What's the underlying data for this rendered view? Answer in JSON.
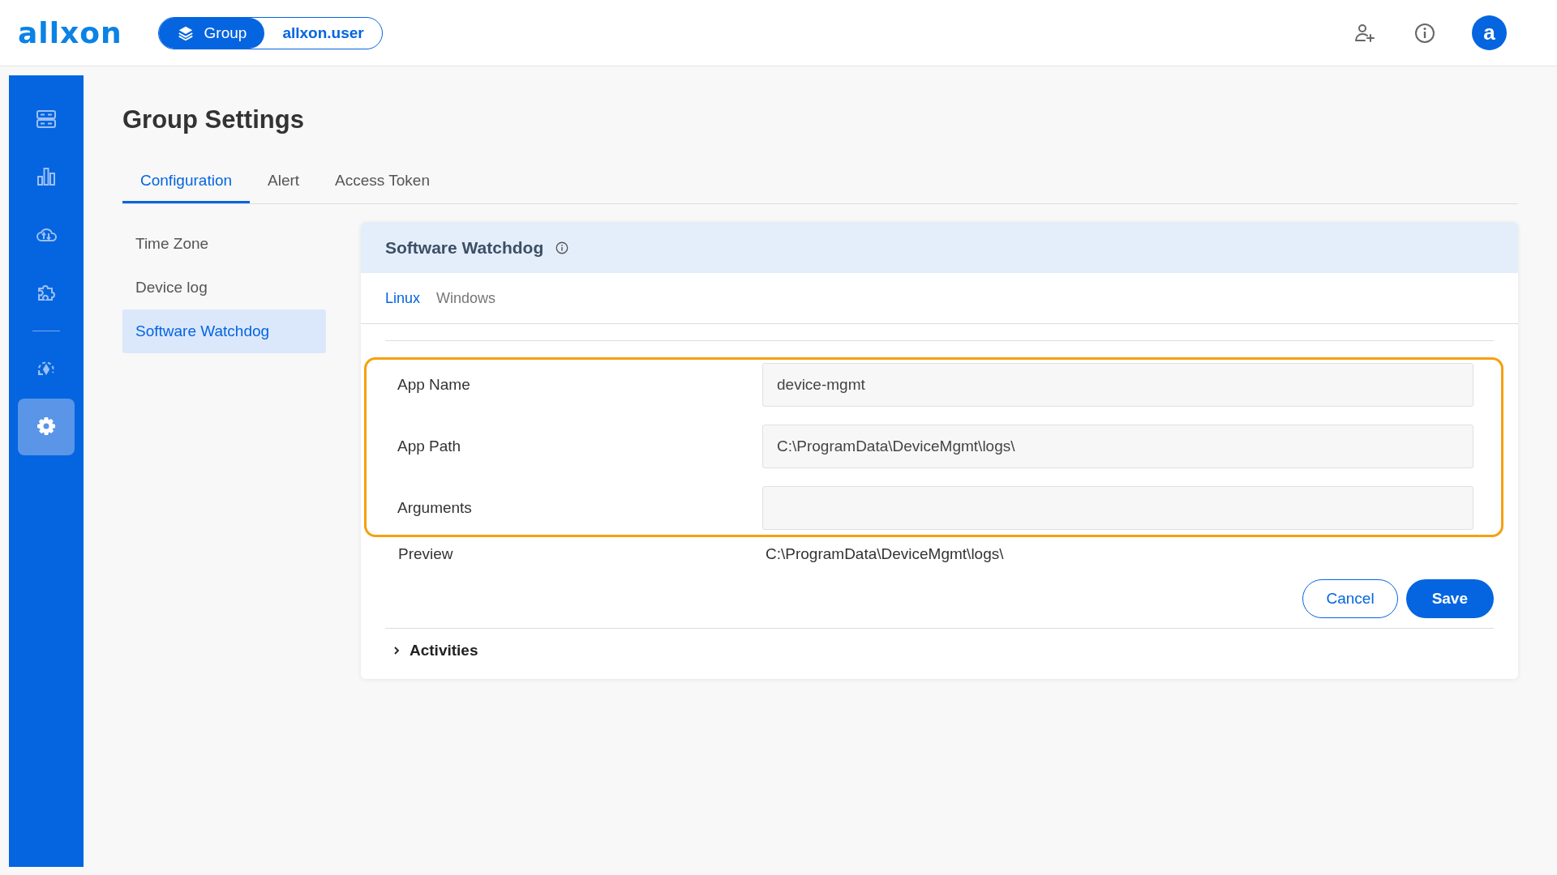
{
  "header": {
    "logo": "allxon",
    "scope_switch": [
      {
        "label": "Group",
        "selected": true
      },
      {
        "label": "allxon.user",
        "selected": false
      }
    ],
    "avatar": "a"
  },
  "sidebar": {
    "items": [
      {
        "kind": "servers",
        "selected": false
      },
      {
        "kind": "chart",
        "selected": false
      },
      {
        "kind": "cloud",
        "selected": false
      },
      {
        "kind": "plugin",
        "selected": false
      },
      {
        "kind": "sync",
        "selected": false
      },
      {
        "kind": "gear",
        "selected": true
      }
    ]
  },
  "page_title": "Group Settings",
  "tabs": [
    {
      "label": "Configuration",
      "selected": true
    },
    {
      "label": "Alert",
      "selected": false
    },
    {
      "label": "Access Token",
      "selected": false
    }
  ],
  "subnav": [
    {
      "label": "Time Zone",
      "selected": false
    },
    {
      "label": "Device log",
      "selected": false
    },
    {
      "label": "Software Watchdog",
      "selected": true
    }
  ],
  "card": {
    "title": "Software Watchdog",
    "os_tabs": [
      {
        "label": "Linux",
        "selected": true
      },
      {
        "label": "Windows",
        "selected": false
      }
    ],
    "fields": [
      {
        "label": "App Name",
        "value": "device-mgmt"
      },
      {
        "label": "App Path",
        "value": "C:\\ProgramData\\DeviceMgmt\\logs\\"
      },
      {
        "label": "Arguments"
      }
    ],
    "preview": {
      "label": "Preview",
      "value": "C:\\ProgramData\\DeviceMgmt\\logs\\"
    },
    "buttons": [
      {
        "label": "Cancel",
        "kind": "outline"
      },
      {
        "label": "Save",
        "kind": "primary"
      }
    ],
    "activities": {
      "label": "Activities",
      "expanded": false
    }
  }
}
